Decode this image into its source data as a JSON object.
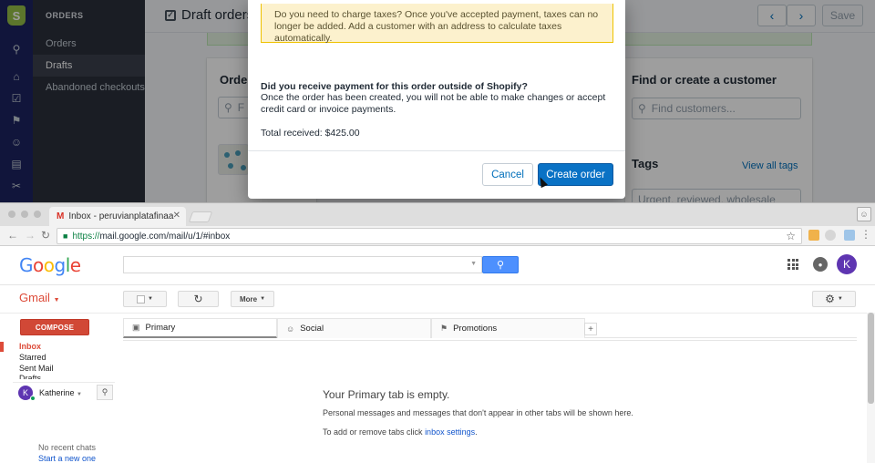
{
  "shopify": {
    "nav_section": "ORDERS",
    "nav_items": [
      "Orders",
      "Drafts",
      "Abandoned checkouts"
    ],
    "page_title": "Draft orders",
    "save_label": "Save",
    "prev_icon": "‹",
    "next_icon": "›",
    "order_card_title": "Order",
    "order_search_placeholder": "F",
    "customer_card_title": "Find or create a customer",
    "customer_search_placeholder": "Find customers...",
    "tags_title": "Tags",
    "tags_link": "View all tags",
    "tags_value": "Urgent, reviewed, wholesale"
  },
  "modal": {
    "tax_notice": "Do you need to charge taxes? Once you've accepted payment, taxes can no longer be added. Add a customer with an address to calculate taxes automatically.",
    "question": "Did you receive payment for this order outside of Shopify?",
    "explanation": "Once the order has been created, you will not be able to make changes or accept credit card or invoice payments.",
    "total": "Total received: $425.00",
    "cancel_label": "Cancel",
    "create_label": "Create order"
  },
  "browser": {
    "tab_title": "Inbox - peruvianplatafinaalerts",
    "url_scheme": "https://",
    "url_rest": "mail.google.com/mail/u/1/#inbox"
  },
  "gmail": {
    "logo_letters": [
      "G",
      "o",
      "o",
      "g",
      "l",
      "e"
    ],
    "app_label": "Gmail",
    "more_label": "More",
    "compose_label": "COMPOSE",
    "folders": [
      "Inbox",
      "Starred",
      "Sent Mail",
      "Drafts"
    ],
    "user_name": "Katherine",
    "user_initial": "K",
    "tabs": [
      "Primary",
      "Social",
      "Promotions"
    ],
    "empty_title": "Your Primary tab is empty.",
    "empty_text": "Personal messages and messages that don't appear in other tabs will be shown here.",
    "settings_text_prefix": "To add or remove tabs click ",
    "settings_link": "inbox settings",
    "settings_text_suffix": ".",
    "no_chats": "No recent chats",
    "start_new": "Start a new one"
  },
  "colors": {
    "shopify_primary": "#0a72c5",
    "gmail_red": "#dd4b39",
    "google_blue": "#4285f4"
  }
}
